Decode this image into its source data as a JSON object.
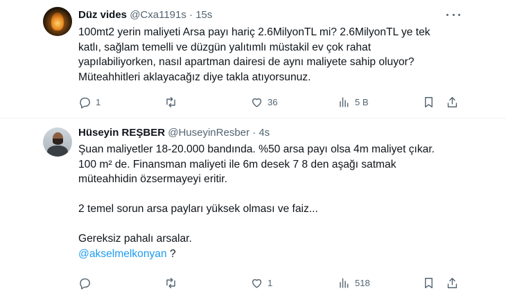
{
  "tweets": [
    {
      "name": "Düz vides",
      "handle": "@Cxa1191s",
      "separator": "·",
      "time": "15s",
      "lines": [
        "100mt2 yerin maliyeti Arsa payı hariç 2.6MilyonTL mi? 2.6MilyonTL ye tek",
        "katlı, sağlam temelli ve düzgün yalıtımlı müstakil ev çok rahat",
        "yapılabiliyorken, nasıl apartman dairesi de aynı maliyete sahip oluyor?",
        "Müteahhitleri aklayacağız diye takla atıyorsunuz."
      ],
      "actions": {
        "reply_count": "1",
        "retweet_count": "",
        "like_count": "36",
        "view_count": "5 B"
      },
      "icons": [
        "reply-icon",
        "retweet-icon",
        "like-icon",
        "views-icon",
        "bookmark-icon",
        "share-icon"
      ]
    },
    {
      "name": "Hüseyin REŞBER",
      "handle": "@HuseyinResber",
      "separator": "·",
      "time": "4s",
      "paragraphs": {
        "p1": [
          "Şuan maliyetler 18-20.000 bandında. %50 arsa payı olsa 4m maliyet çıkar.",
          "100 m² de. Finansman maliyeti ile 6m desek 7 8 den aşağı satmak",
          "müteahhidin özsermayeyi eritir."
        ],
        "p2": "2 temel sorun arsa payları yüksek olması ve faiz...",
        "p3": "Gereksiz pahalı arsalar.",
        "mention": "@akselmelkonyan",
        "mention_suffix": " ?"
      },
      "actions": {
        "reply_count": "",
        "retweet_count": "",
        "like_count": "1",
        "view_count": "518"
      },
      "icons": [
        "reply-icon",
        "retweet-icon",
        "like-icon",
        "views-icon",
        "bookmark-icon",
        "share-icon"
      ]
    }
  ]
}
